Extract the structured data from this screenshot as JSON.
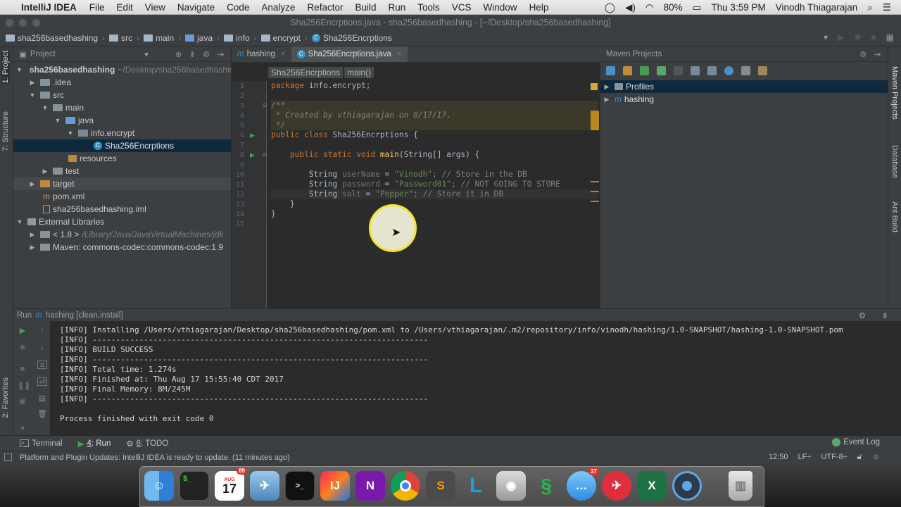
{
  "menubar": {
    "app": "IntelliJ IDEA",
    "items": [
      "File",
      "Edit",
      "View",
      "Navigate",
      "Code",
      "Analyze",
      "Refactor",
      "Build",
      "Run",
      "Tools",
      "VCS",
      "Window",
      "Help"
    ],
    "battery": "80%",
    "time": "Thu 3:59 PM",
    "user": "Vinodh Thiagarajan"
  },
  "window": {
    "title": "Sha256Encrptions.java - sha256basedhashing - [~/Desktop/sha256basedhashing]"
  },
  "breadcrumbs": [
    "sha256basedhashing",
    "src",
    "main",
    "java",
    "info",
    "encrypt",
    "Sha256Encrptions"
  ],
  "project_panel": {
    "title": "Project",
    "tree": [
      {
        "label": "sha256basedhashing",
        "hint": "~/Desktop/sha256basedhashing"
      },
      {
        "label": ".idea"
      },
      {
        "label": "src"
      },
      {
        "label": "main"
      },
      {
        "label": "java"
      },
      {
        "label": "info.encrypt"
      },
      {
        "label": "Sha256Encrptions"
      },
      {
        "label": "resources"
      },
      {
        "label": "test"
      },
      {
        "label": "target"
      },
      {
        "label": "pom.xml"
      },
      {
        "label": "sha256basedhashing.iml"
      },
      {
        "label": "External Libraries"
      },
      {
        "label": "< 1.8 >",
        "hint": "/Library/Java/JavaVirtualMachines/jdk"
      },
      {
        "label": "Maven: commons-codec:commons-codec:1.9"
      }
    ]
  },
  "side_tools": {
    "left": [
      "1: Project",
      "7: Structure",
      "2: Favorites"
    ],
    "right": [
      "Maven Projects",
      "Database",
      "Ant Build"
    ]
  },
  "editor": {
    "tabs": [
      "hashing",
      "Sha256Encrptions.java"
    ],
    "crumbs": [
      "Sha256Encrptions",
      "main()"
    ],
    "line_numbers": [
      "1",
      "2",
      "3",
      "4",
      "5",
      "6",
      "7",
      "8",
      "9",
      "10",
      "11",
      "12",
      "13",
      "14",
      "15"
    ],
    "code": {
      "l1a": "package ",
      "l1b": "info.encrypt;",
      "l3": "/**",
      "l4": " * Created by vthiagarajan on 8/17/17.",
      "l5": " */",
      "l6a": "public class ",
      "l6b": "Sha256Encrptions {",
      "l8a": "    public static void ",
      "l8b": "main",
      "l8c": "(String[] args) {",
      "l10a": "        String ",
      "l10b": "userName",
      "l10c": " = ",
      "l10d": "\"Vinodh\"",
      "l10e": "; // Store in the DB",
      "l11a": "        String ",
      "l11b": "password",
      "l11c": " = ",
      "l11d": "\"Password01\"",
      "l11e": "; // NOT GOING TO STORE",
      "l12a": "        String ",
      "l12b": "salt",
      "l12c": " = ",
      "l12d": "\"Pepper\"",
      "l12e": "; // Store it in DB",
      "l13": "    }",
      "l14": "}"
    }
  },
  "maven_panel": {
    "title": "Maven Projects",
    "items": [
      "Profiles",
      "hashing"
    ]
  },
  "run_panel": {
    "title": "Run",
    "config": "hashing [clean,install]"
  },
  "console": [
    "[INFO] Installing /Users/vthiagarajan/Desktop/sha256basedhashing/pom.xml to /Users/vthiagarajan/.m2/repository/info/vinodh/hashing/1.0-SNAPSHOT/hashing-1.0-SNAPSHOT.pom",
    "[INFO] ------------------------------------------------------------------------",
    "[INFO] BUILD SUCCESS",
    "[INFO] ------------------------------------------------------------------------",
    "[INFO] Total time: 1.274s",
    "[INFO] Finished at: Thu Aug 17 15:55:40 CDT 2017",
    "[INFO] Final Memory: 8M/245M",
    "[INFO] ------------------------------------------------------------------------",
    "",
    "Process finished with exit code 0"
  ],
  "bottom_tabs": {
    "terminal": "Terminal",
    "run_num": "4",
    "run": ": Run",
    "todo_num": "6",
    "todo": ": TODO",
    "event_log": "Event Log"
  },
  "statusbar": {
    "message": "Platform and Plugin Updates: IntelliJ IDEA is ready to update. (11 minutes ago)",
    "position": "12:50",
    "line_sep": "LF÷",
    "encoding": "UTF-8÷"
  },
  "dock": {
    "calendar_month": "AUG",
    "calendar_day": "17",
    "calendar_badge": "89",
    "messages_badge": "37"
  }
}
